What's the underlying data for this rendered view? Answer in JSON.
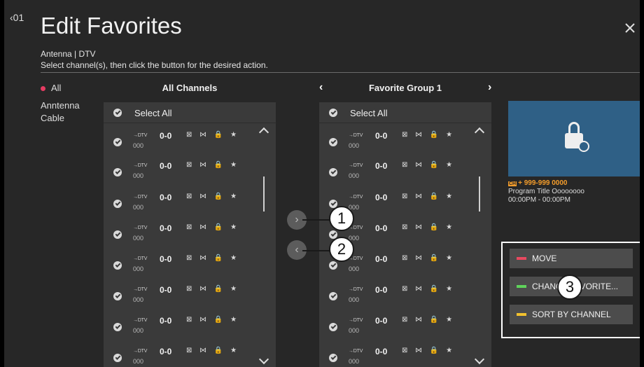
{
  "header": {
    "channel_indicator": "‹01",
    "title": "Edit Favorites",
    "subtitle": "Antenna | DTV",
    "instructions": "Select channel(s), then click the button for the desired action."
  },
  "categories": [
    {
      "label": "All",
      "selected": true
    },
    {
      "label": "Anntenna",
      "selected": false
    },
    {
      "label": "Cable",
      "selected": false
    }
  ],
  "left_list": {
    "title": "All Channels",
    "select_all": "Select All",
    "rows": [
      {
        "source": "→DTV",
        "number": "0-0",
        "name": "000"
      },
      {
        "source": "→DTV",
        "number": "0-0",
        "name": "000"
      },
      {
        "source": "→DTV",
        "number": "0-0",
        "name": "000"
      },
      {
        "source": "→DTV",
        "number": "0-0",
        "name": "000"
      },
      {
        "source": "→DTV",
        "number": "0-0",
        "name": "000"
      },
      {
        "source": "→DTV",
        "number": "0-0",
        "name": "000"
      },
      {
        "source": "→DTV",
        "number": "0-0",
        "name": "000"
      },
      {
        "source": "→DTV",
        "number": "0-0",
        "name": "000"
      }
    ]
  },
  "right_list": {
    "title": "Favorite Group 1",
    "prev_arrow": "‹",
    "next_arrow": "›",
    "select_all": "Select All",
    "rows": [
      {
        "source": "→DTV",
        "number": "0-0",
        "name": "000"
      },
      {
        "source": "→DTV",
        "number": "0-0",
        "name": "000"
      },
      {
        "source": "→DTV",
        "number": "0-0",
        "name": "000"
      },
      {
        "source": "→DTV",
        "number": "0-0",
        "name": "000"
      },
      {
        "source": "→DTV",
        "number": "0-0",
        "name": "000"
      },
      {
        "source": "→DTV",
        "number": "0-0",
        "name": "000"
      },
      {
        "source": "→DTV",
        "number": "0-0",
        "name": "000"
      },
      {
        "source": "→DTV",
        "number": "0-0",
        "name": "000"
      }
    ]
  },
  "row_icons": "⊠ ⋈ 🔒 ★",
  "transfer": {
    "add_symbol": "›",
    "remove_symbol": "‹"
  },
  "preview": {
    "icon": "lock-person-icon",
    "channel_badge": "CH",
    "channel": "+ 999-999 0000",
    "program_title": "Program Title Oooooooo",
    "time": "00:00PM - 00:00PM"
  },
  "actions": [
    {
      "label": "MOVE",
      "color": "#e8495f"
    },
    {
      "label": "CHANGE FAVORITE...",
      "color": "#5fd35b"
    },
    {
      "label": "SORT BY CHANNEL",
      "color": "#f2c12e"
    }
  ],
  "callouts": [
    "1",
    "2",
    "3"
  ],
  "colors": {
    "accent": "#e63c62",
    "orange": "#f39c2b",
    "preview_bg": "#2f6086"
  }
}
